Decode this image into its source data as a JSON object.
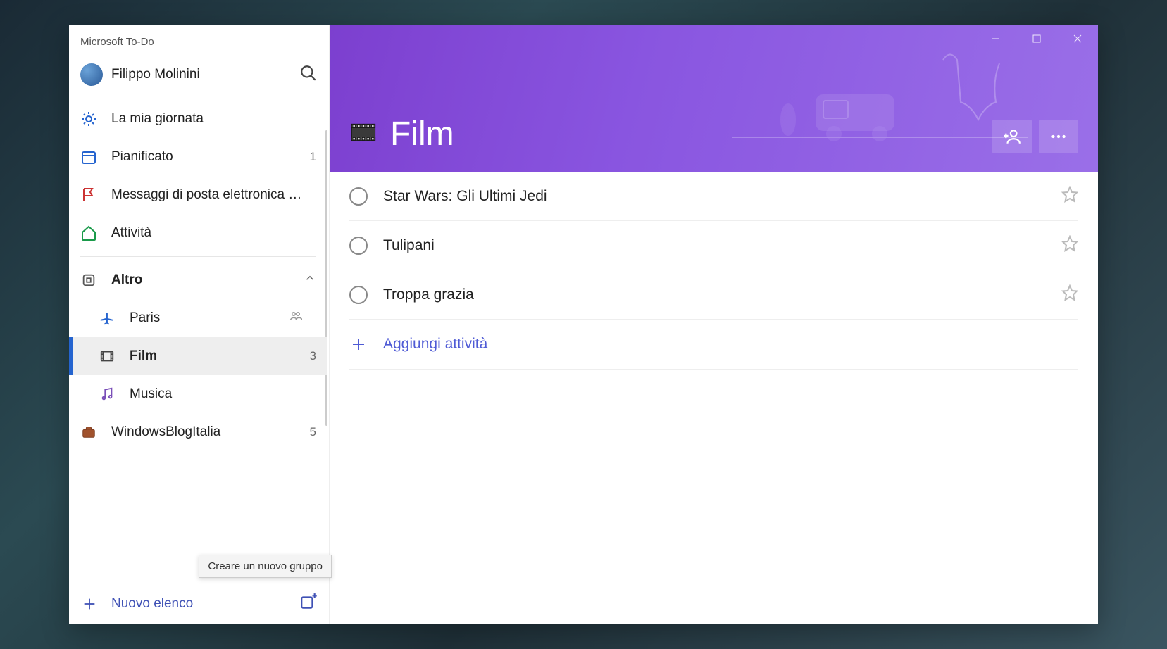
{
  "app_title": "Microsoft To-Do",
  "user_name": "Filippo Molinini",
  "current_list": {
    "title": "Film",
    "icon": "film-icon"
  },
  "nav_smart": [
    {
      "icon": "sun-icon",
      "label": "La mia giornata",
      "count": ""
    },
    {
      "icon": "calendar-icon",
      "label": "Pianificato",
      "count": "1"
    },
    {
      "icon": "flag-icon",
      "label": "Messaggi di posta elettronica c...",
      "count": ""
    },
    {
      "icon": "home-icon",
      "label": "Attività",
      "count": ""
    }
  ],
  "group": {
    "label": "Altro",
    "items": [
      {
        "icon": "airplane-icon",
        "label": "Paris",
        "shared": true,
        "count": "",
        "active": false
      },
      {
        "icon": "film-icon-small",
        "label": "Film",
        "shared": false,
        "count": "3",
        "active": true
      },
      {
        "icon": "music-icon",
        "label": "Musica",
        "shared": false,
        "count": "",
        "active": false
      }
    ]
  },
  "extra_list": {
    "icon": "briefcase-icon",
    "label": "WindowsBlogItalia",
    "count": "5"
  },
  "new_list_label": "Nuovo elenco",
  "tooltip_text": "Creare un nuovo gruppo",
  "tasks": [
    {
      "text": "Star Wars: Gli Ultimi Jedi"
    },
    {
      "text": "Tulipani"
    },
    {
      "text": "Troppa grazia"
    }
  ],
  "add_task_label": "Aggiungi attività"
}
